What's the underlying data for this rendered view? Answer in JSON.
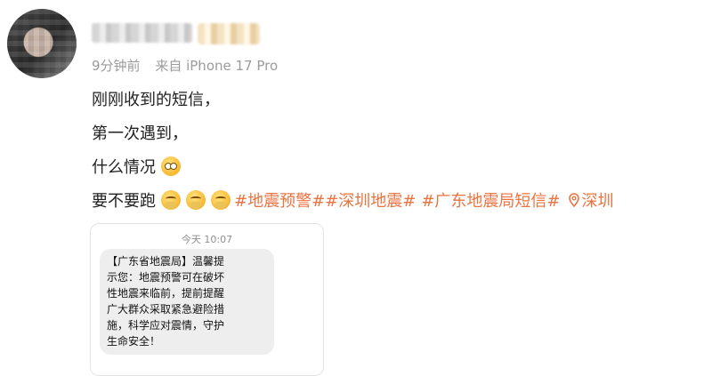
{
  "post": {
    "meta": {
      "time": "9分钟前",
      "source": "来自 iPhone 17 Pro"
    },
    "lines": [
      "刚刚收到的短信，",
      "第一次遇到，",
      "什么情况",
      "要不要跑"
    ],
    "emojis": {
      "line3": "flushed-face",
      "line4": [
        "praying-face",
        "praying-face",
        "praying-face"
      ]
    },
    "hashtags": [
      "#地震预警#",
      "#深圳地震#",
      "#广东地震局短信#"
    ],
    "location": "深圳",
    "accent_color": "#eb7340"
  },
  "sms": {
    "time": "今天 10:07",
    "body_lines": [
      "【广东省地震局】温馨提",
      "示您：地震预警可在破坏",
      "性地震来临前，提前提醒",
      "广大群众采取紧急避险措",
      "施，科学应对震情，守护",
      "生命安全！"
    ]
  }
}
